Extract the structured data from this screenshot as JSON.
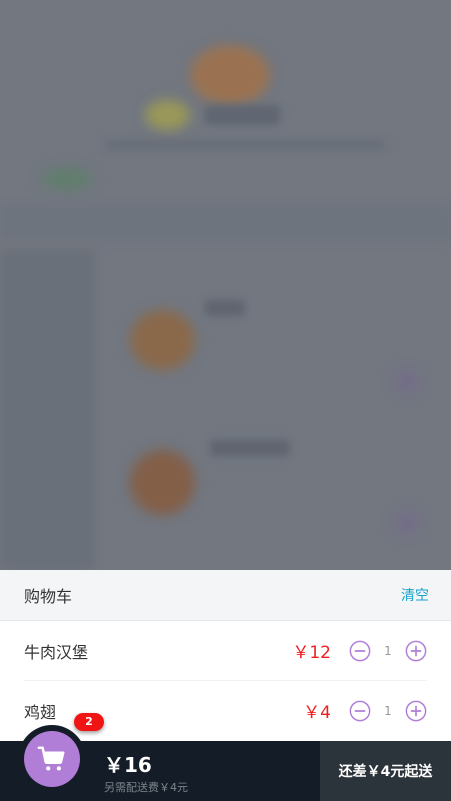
{
  "cart": {
    "title": "购物车",
    "clear_label": "清空",
    "items": [
      {
        "name": "牛肉汉堡",
        "price": "￥12",
        "quantity": "1"
      },
      {
        "name": "鸡翅",
        "price": "￥4",
        "quantity": "1"
      }
    ]
  },
  "footer": {
    "badge_count": "2",
    "total_price": "￥16",
    "delivery_fee": "另需配送费￥4元",
    "pay_label": "还差￥4元起送"
  },
  "colors": {
    "accent": "#b07ed6",
    "price_red": "#ef1f1f",
    "clear_link": "#1aa3c9",
    "footer_bg": "#141d27",
    "pay_btn_bg": "#2b333b"
  },
  "icons": {
    "cart": "shopping-cart-icon",
    "decrease": "minus-circle-icon",
    "increase": "plus-circle-icon"
  }
}
